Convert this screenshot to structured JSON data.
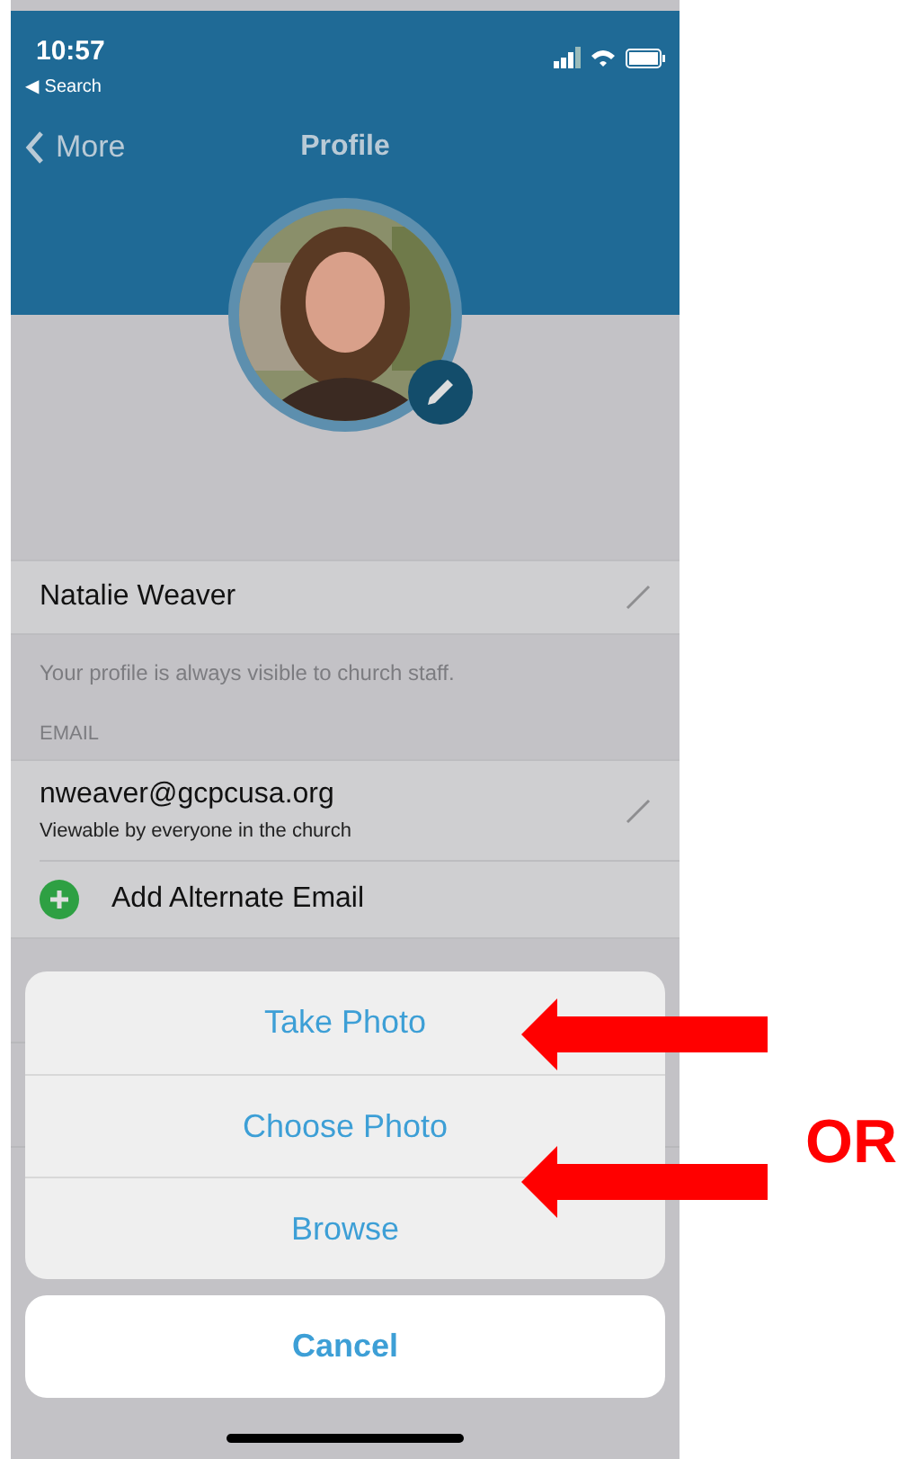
{
  "status_bar": {
    "time": "10:57",
    "back_app": "◀ Search"
  },
  "nav": {
    "back": "More",
    "title": "Profile"
  },
  "profile": {
    "name": "Natalie Weaver",
    "note": "Your profile is always visible to church staff."
  },
  "email_section": {
    "header": "EMAIL",
    "email": "nweaver@gcpcusa.org",
    "visibility": "Viewable by everyone in the church",
    "add": "Add Alternate Email"
  },
  "action_sheet": {
    "actions": [
      "Take Photo",
      "Choose Photo",
      "Browse"
    ],
    "cancel": "Cancel"
  },
  "annotation": {
    "text": "OR"
  }
}
